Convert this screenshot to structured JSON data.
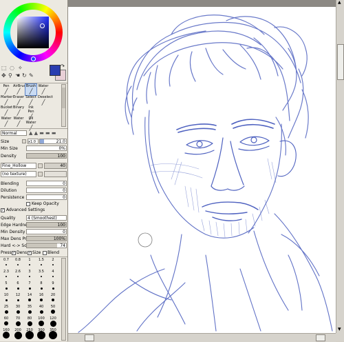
{
  "tools": [
    {
      "label": "Pen",
      "icon": "pen-icon"
    },
    {
      "label": "AirBrush",
      "icon": "airbrush-icon"
    },
    {
      "label": "Brush",
      "icon": "brush-icon"
    },
    {
      "label": "Water",
      "icon": "water-icon"
    },
    {
      "label": "Marker",
      "icon": "marker-icon"
    },
    {
      "label": "Eraser",
      "icon": "eraser-icon"
    },
    {
      "label": "Select",
      "icon": "select-icon"
    },
    {
      "label": "Deselect",
      "icon": "deselect-icon"
    },
    {
      "label": "Bucket",
      "icon": "bucket-icon"
    },
    {
      "label": "Binary",
      "icon": "binary-icon"
    },
    {
      "label": "Ink Pen",
      "icon": "ink-pen-icon"
    },
    {
      "label": "",
      "icon": ""
    },
    {
      "label": "Water",
      "icon": "water-icon"
    },
    {
      "label": "Water",
      "icon": "water-icon"
    },
    {
      "label": "Oil Water",
      "icon": "oil-water-icon"
    },
    {
      "label": "",
      "icon": ""
    }
  ],
  "colors": {
    "primary": "#2a3db0",
    "secondary": "#e8cfd6",
    "selected_tool_bg": "#c9dbf3"
  },
  "blend_mode": "Normal",
  "size": {
    "label": "Size",
    "multiplier": "x1.0",
    "value": "21.0"
  },
  "min_size": {
    "label": "Min Size",
    "value": "0%"
  },
  "density": {
    "label": "Density",
    "value": "100"
  },
  "shape": {
    "name": "Fine_Hollow",
    "value": "40"
  },
  "texture": {
    "name": "(no texture)"
  },
  "blending": {
    "label": "Blending",
    "value": "0"
  },
  "dilution": {
    "label": "Dilution",
    "value": "0"
  },
  "persistence": {
    "label": "Persistence",
    "value": "0"
  },
  "keep_opacity": "Keep Opacity",
  "advanced_settings": "Advanced Settings",
  "quality": {
    "label": "Quality",
    "value": "4 (Smoothest)"
  },
  "edge_hardness": {
    "label": "Edge Hardness",
    "value": "100"
  },
  "min_density": {
    "label": "Min Density",
    "value": "0"
  },
  "max_dens_prs": {
    "label": "Max Dens Prs.",
    "value": "100%"
  },
  "hard_soft": {
    "label": "Hard <-> Soft",
    "value": "74"
  },
  "press": {
    "label": "Press:",
    "dens": "Dens",
    "size": "Size",
    "blend": "Blend"
  },
  "brush_sizes": [
    "0.7",
    "0.8",
    "1",
    "1.5",
    "2",
    "2.3",
    "2.6",
    "3",
    "3.5",
    "4",
    "5",
    "6",
    "7",
    "8",
    "9",
    "10",
    "12",
    "14",
    "16",
    "20",
    "25",
    "30",
    "35",
    "40",
    "50",
    "60",
    "70",
    "80",
    "100",
    "120",
    "160",
    "200",
    "250",
    "300",
    "350"
  ]
}
